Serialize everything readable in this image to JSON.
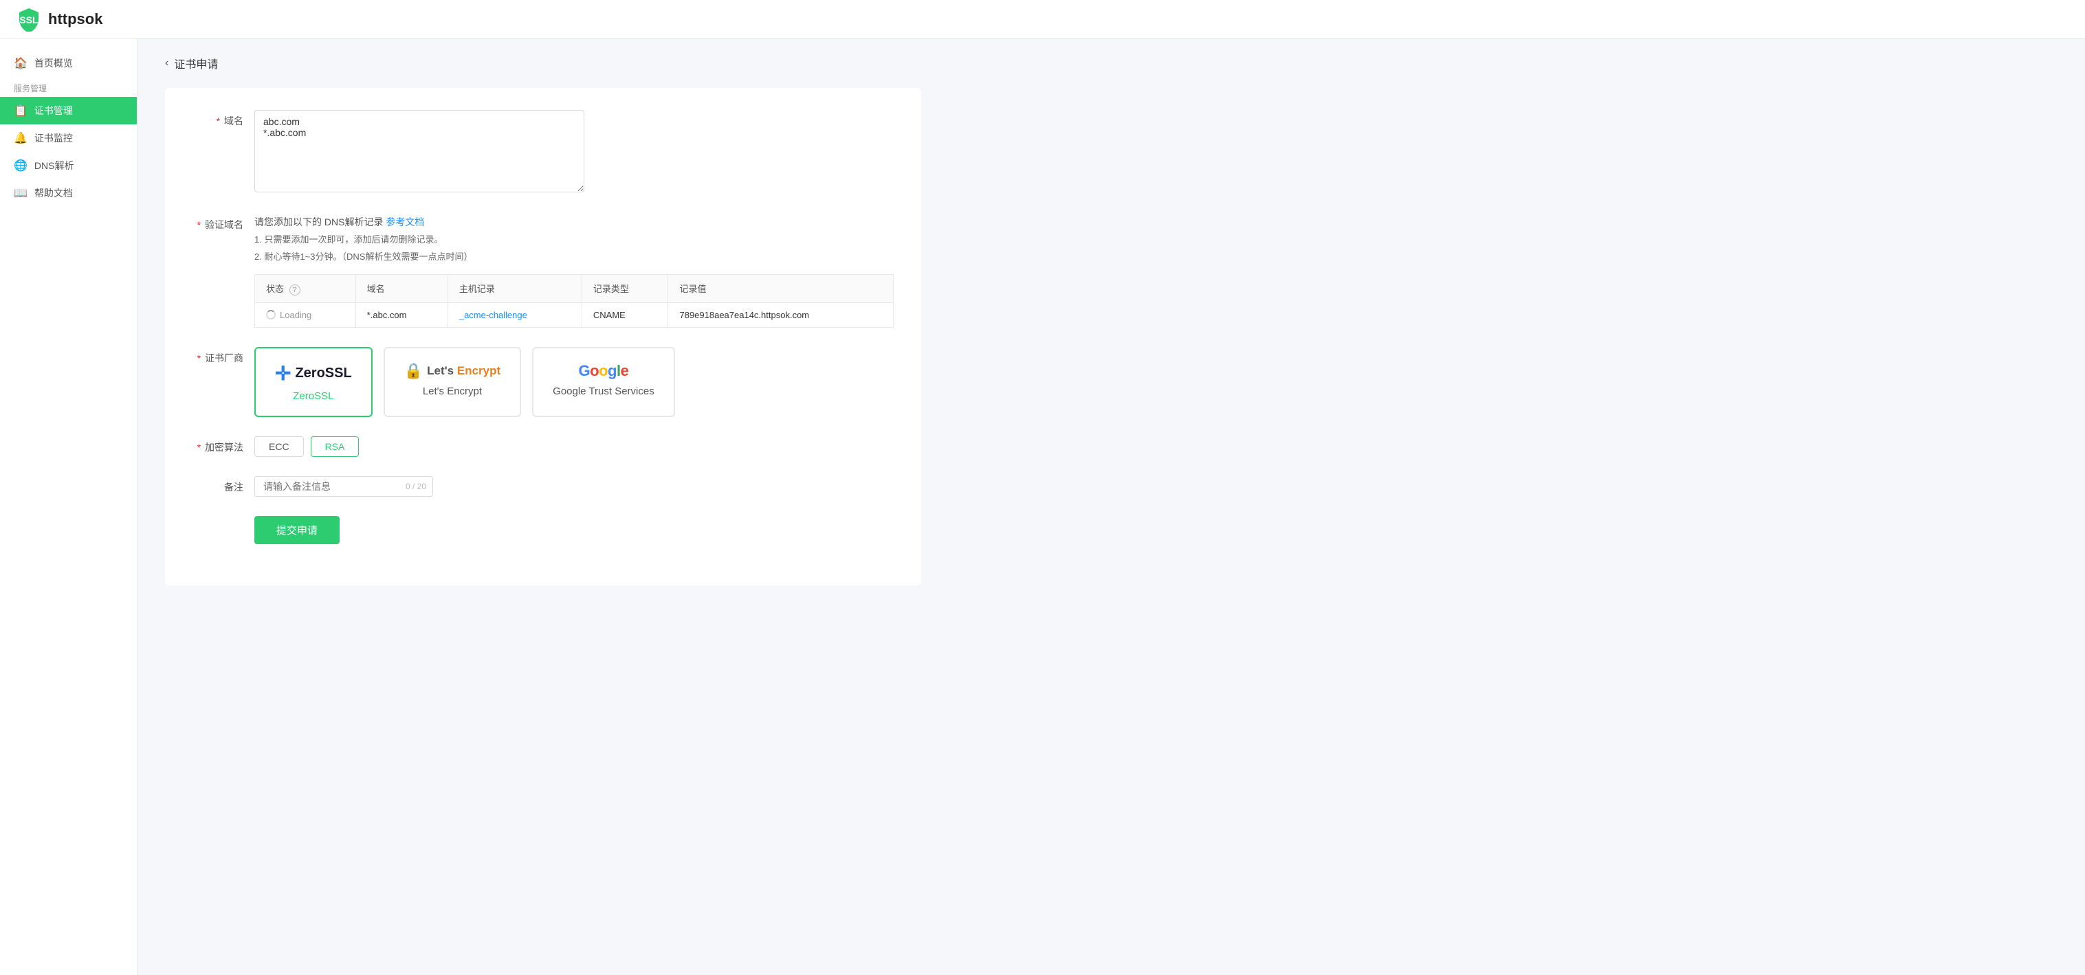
{
  "app": {
    "title": "httpsok",
    "logo_alt": "SSL Shield Logo"
  },
  "header": {
    "brand": "httpsok"
  },
  "sidebar": {
    "group_label": "服务管理",
    "items": [
      {
        "id": "home",
        "label": "首页概览",
        "icon": "🏠",
        "active": false
      },
      {
        "id": "cert-management",
        "label": "证书管理",
        "icon": "📋",
        "active": true
      },
      {
        "id": "cert-monitor",
        "label": "证书监控",
        "icon": "🔔",
        "active": false
      },
      {
        "id": "dns",
        "label": "DNS解析",
        "icon": "🌐",
        "active": false
      },
      {
        "id": "help",
        "label": "帮助文档",
        "icon": "📖",
        "active": false
      }
    ]
  },
  "page": {
    "back_label": "‹",
    "title": "证书申请"
  },
  "form": {
    "domain_label": "域名",
    "domain_required": "* 域名",
    "domain_value": "abc.com\n*.abc.com",
    "domain_placeholder": "",
    "verify_domain_label": "* 验证域名",
    "verify_info_text": "请您添加以下的 DNS解析记录",
    "verify_link_text": "参考文档",
    "verify_note1": "1. 只需要添加一次即可，添加后请勿删除记录。",
    "verify_note2": "2. 耐心等待1~3分钟。（DNS解析生效需要一点点时间）",
    "table": {
      "headers": [
        "状态",
        "域名",
        "主机记录",
        "记录类型",
        "记录值"
      ],
      "status_tooltip": "?",
      "row": {
        "status": "Loading",
        "domain": "*.abc.com",
        "host_record": "_acme-challenge",
        "record_type": "CNAME",
        "record_value": "789e918aea7ea14c.httpsok.com"
      }
    },
    "vendor_label": "* 证书厂商",
    "vendors": [
      {
        "id": "zerossl",
        "name": "ZeroSSL",
        "selected": true
      },
      {
        "id": "letsencrypt",
        "name": "Let's Encrypt",
        "selected": false
      },
      {
        "id": "google",
        "name": "Google Trust Services",
        "selected": false
      }
    ],
    "algo_label": "* 加密算法",
    "algo_options": [
      {
        "id": "ecc",
        "label": "ECC",
        "selected": false
      },
      {
        "id": "rsa",
        "label": "RSA",
        "selected": true
      }
    ],
    "remarks_label": "备注",
    "remarks_placeholder": "请输入备注信息",
    "remarks_count": "0 / 20",
    "submit_label": "提交申请"
  }
}
